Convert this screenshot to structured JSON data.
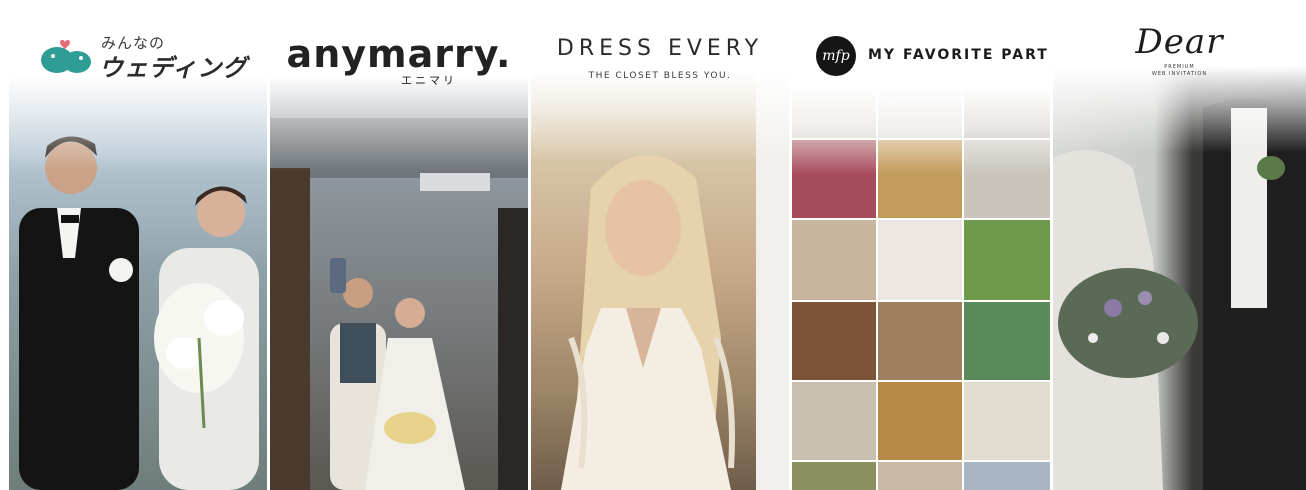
{
  "cards": [
    {
      "logo_text_top": "みんなの",
      "logo_text_main": "ウェディング"
    },
    {
      "logo_text_main": "anymarry.",
      "logo_text_sub": "エニマリ"
    },
    {
      "logo_text_main": "DRESS EVERY",
      "logo_text_sub": "THE CLOSET BLESS YOU."
    },
    {
      "logo_mark": "mfp",
      "logo_text_main": "MY FAVORITE PART"
    },
    {
      "logo_text_main": "Dear",
      "logo_text_sub1": "PREMIUM",
      "logo_text_sub2": "WEB INVITATION"
    }
  ],
  "colors": {
    "mw_brand_teal": "#2f9c96",
    "mw_brand_heart": "#e86b7c",
    "dark_text": "#222222"
  }
}
